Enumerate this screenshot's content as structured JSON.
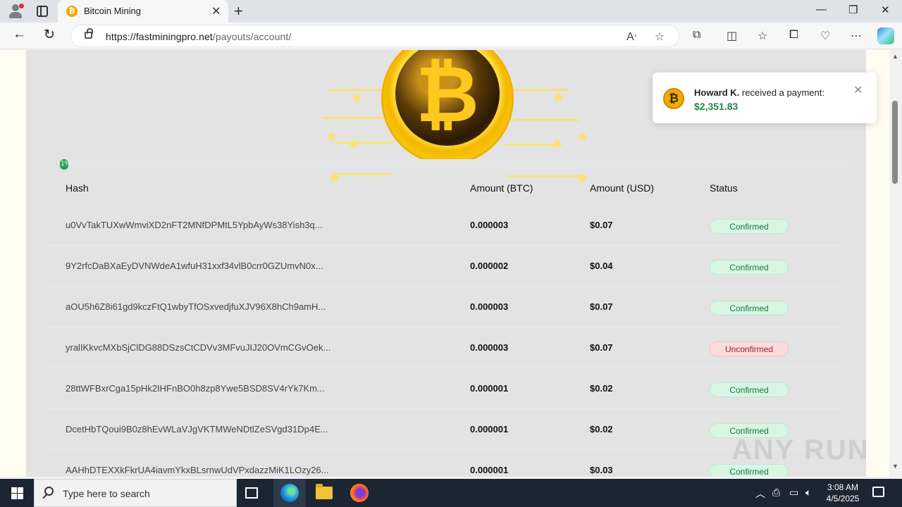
{
  "browser": {
    "tab_title": "Bitcoin Mining",
    "tab_favicon": "bitcoin-icon",
    "url_host": "https://fastminingpro.net",
    "url_path": "/payouts/account/"
  },
  "progress": {
    "label": "1%",
    "fraction": 0.01,
    "color": "#22a45d"
  },
  "table": {
    "headers": [
      "Hash",
      "Amount (BTC)",
      "Amount (USD)",
      "Status"
    ],
    "rows": [
      {
        "hash": "u0VvTakTUXwWmviXD2nFT2MNfDPMtL5YpbAyWs38Yish3q...",
        "btc": "0.000003",
        "usd": "$0.07",
        "status": "Confirmed",
        "ok": true
      },
      {
        "hash": "9Y2rfcDaBXaEyDVNWdeA1wfuH31xxf34vlB0crr0GZUmvN0x...",
        "btc": "0.000002",
        "usd": "$0.04",
        "status": "Confirmed",
        "ok": true
      },
      {
        "hash": "aOU5h6Z8i61gd9kczFtQ1wbyTfOSxvedjfuXJV96X8hCh9amH...",
        "btc": "0.000003",
        "usd": "$0.07",
        "status": "Confirmed",
        "ok": true
      },
      {
        "hash": "yralIKkvcMXbSjClDG88DSzsCtCDVv3MFvuJIJ20OVmCGvOek...",
        "btc": "0.000003",
        "usd": "$0.07",
        "status": "Unconfirmed",
        "ok": false
      },
      {
        "hash": "28ttWFBxrCga15pHk2IHFnBO0h8zp8Ywe5BSD8SV4rYk7Km...",
        "btc": "0.000001",
        "usd": "$0.02",
        "status": "Confirmed",
        "ok": true
      },
      {
        "hash": "DcetHbTQoui9B0z8hEvWLaVJgVKTMWeNDtlZeSVgd31Dp4E...",
        "btc": "0.000001",
        "usd": "$0.02",
        "status": "Confirmed",
        "ok": true
      },
      {
        "hash": "AAHhDTEXXkFkrUA4iavmYkxBLsrnwUdVPxdazzMiK1LOzy26...",
        "btc": "0.000001",
        "usd": "$0.03",
        "status": "Confirmed",
        "ok": true
      }
    ]
  },
  "toast": {
    "name": "Howard K.",
    "message": " received a payment:",
    "amount": "$2,351.83"
  },
  "watermark": "ANY RUN",
  "taskbar": {
    "search_placeholder": "Type here to search",
    "time": "3:08 AM",
    "date": "4/5/2025"
  },
  "colors": {
    "confirmed_bg": "#d9f5e4",
    "unconfirmed_bg": "#fbdcdc",
    "accent_gold": "#f2a900"
  }
}
